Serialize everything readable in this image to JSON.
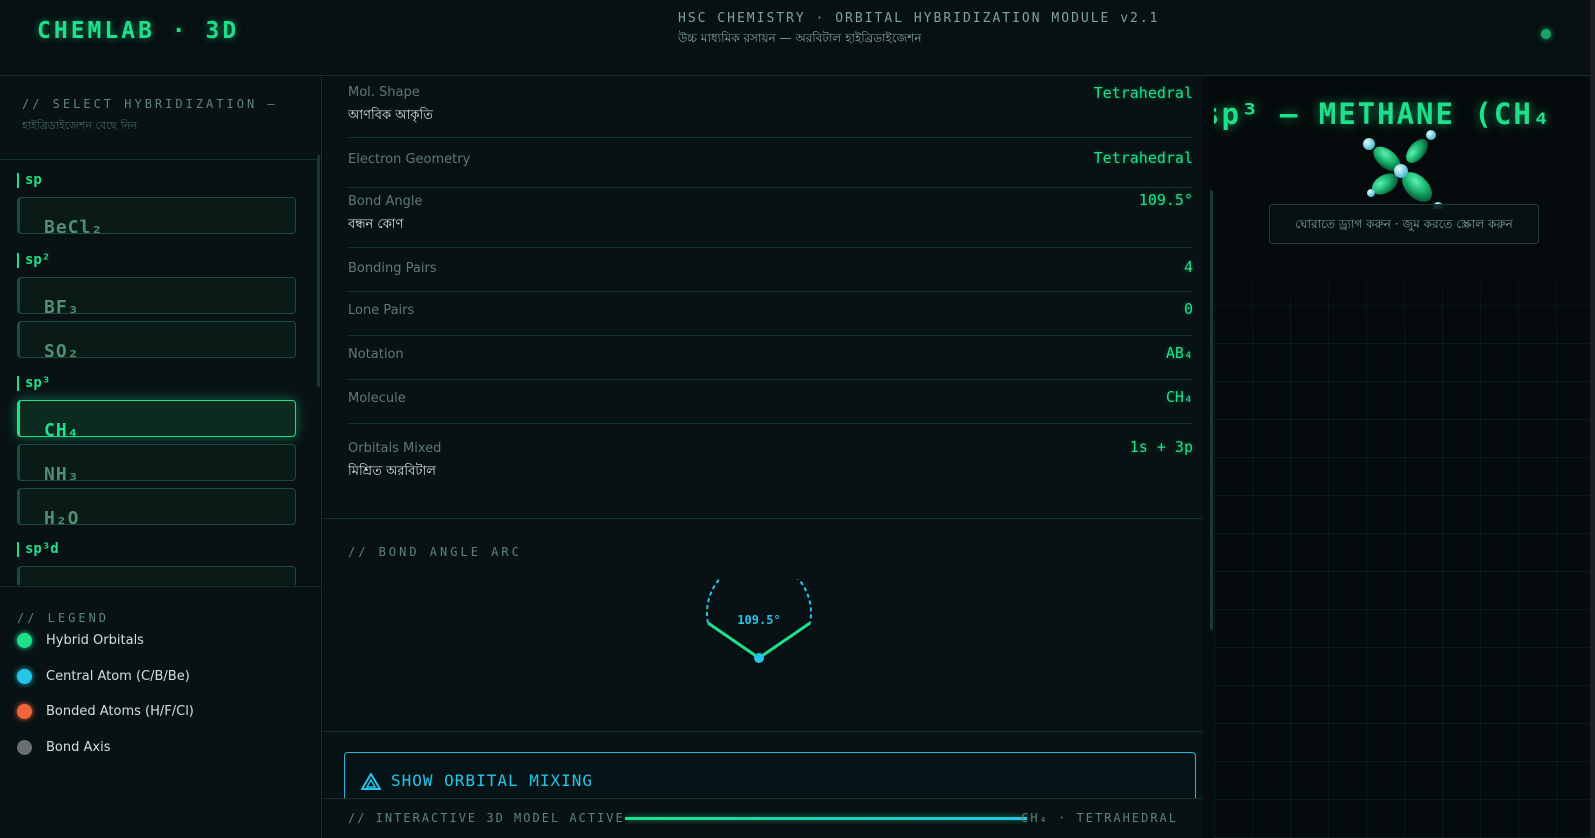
{
  "header": {
    "logo": "CHEMLAB · 3D",
    "title": "HSC CHEMISTRY · ORBITAL HYBRIDIZATION MODULE v2.1",
    "subtitle": "উচ্চ মাধ্যমিক রসায়ন — অরবিটাল হাইব্রিডাইজেশন"
  },
  "sidebar": {
    "title": "// SELECT HYBRIDIZATION —",
    "subtitle": "হাইব্রিডাইজেশন বেছে নিন",
    "groups": [
      {
        "label": "sp",
        "molecules": [
          "BeCl₂"
        ]
      },
      {
        "label": "sp²",
        "molecules": [
          "BF₃",
          "SO₂"
        ]
      },
      {
        "label": "sp³",
        "molecules": [
          "CH₄",
          "NH₃",
          "H₂O"
        ]
      },
      {
        "label": "sp³d",
        "molecules": []
      }
    ],
    "selected": "CH₄"
  },
  "legend": {
    "title": "// LEGEND",
    "items": [
      {
        "label": "Hybrid Orbitals",
        "color": "#1fe08a"
      },
      {
        "label": "Central Atom (C/B/Be)",
        "color": "#23c6e8"
      },
      {
        "label": "Bonded Atoms (H/F/Cl)",
        "color": "#f0663a"
      },
      {
        "label": "Bond Axis",
        "color": "#6b6f70"
      }
    ]
  },
  "properties": [
    {
      "label": "Mol. Shape",
      "sub": "আণবিক আকৃতি",
      "value": "Tetrahedral"
    },
    {
      "label": "Electron Geometry",
      "sub": "",
      "value": "Tetrahedral"
    },
    {
      "label": "Bond Angle",
      "sub": "বন্ধন কোণ",
      "value": "109.5°"
    },
    {
      "label": "Bonding Pairs",
      "sub": "",
      "value": "4"
    },
    {
      "label": "Lone Pairs",
      "sub": "",
      "value": "0"
    },
    {
      "label": "Notation",
      "sub": "",
      "value": "AB₄"
    },
    {
      "label": "Molecule",
      "sub": "",
      "value": "CH₄"
    },
    {
      "label": "Orbitals Mixed",
      "sub": "মিশ্রিত অরবিটাল",
      "value": "1s + 3p"
    }
  ],
  "arc": {
    "title": "// BOND ANGLE ARC",
    "angle_label": "109.5°"
  },
  "mixing_button": "SHOW ORBITAL MIXING",
  "footer": {
    "left": "// INTERACTIVE 3D MODEL ACTIVE",
    "right": "CH₄ · TETRAHEDRAL",
    "progress": 1.0
  },
  "viewport": {
    "title": "sp³ — METHANE (CH₄",
    "hint": "ঘোরাতে ড্র্যাগ করুন · জুম করতে স্ক্রোল করুন"
  },
  "colors": {
    "accent": "#1fe08a",
    "cyan": "#23c6e8",
    "background": "#060b0d"
  }
}
